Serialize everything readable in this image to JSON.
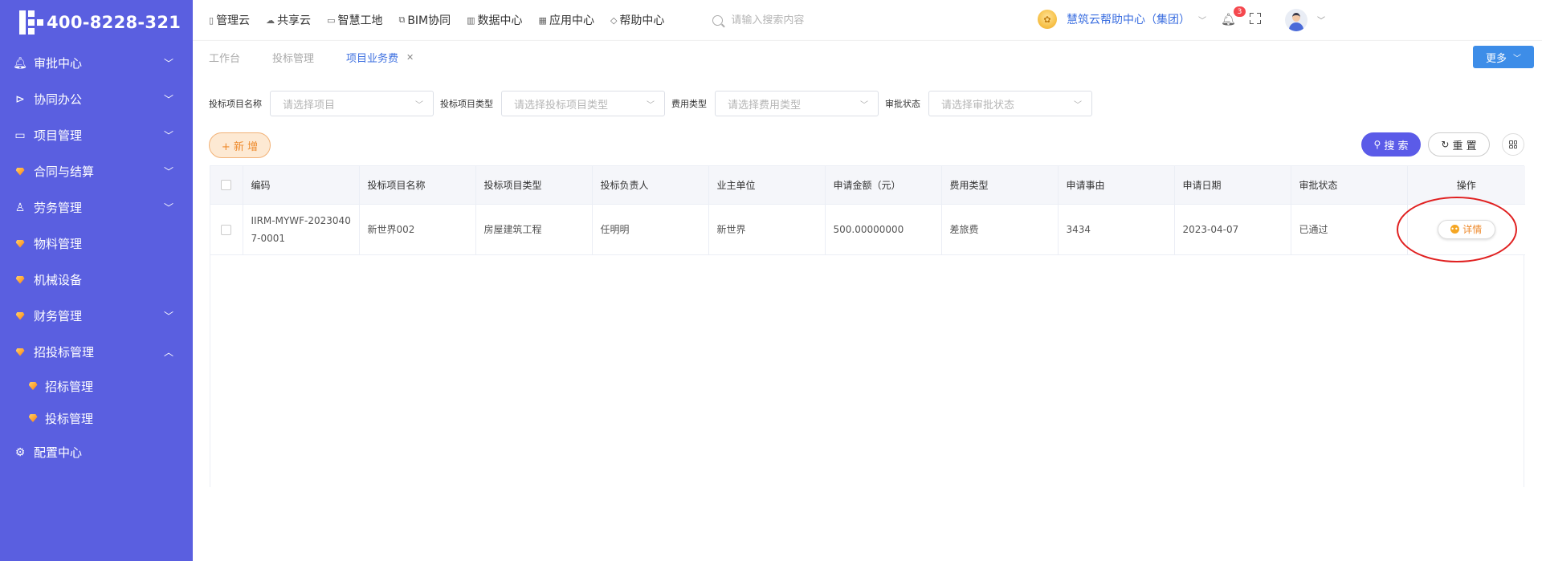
{
  "app": {
    "logo_text": "400-8228-321"
  },
  "sidebar": {
    "items": [
      {
        "label": "审批中心",
        "icon": "bell-icon",
        "expanded": false
      },
      {
        "label": "协同办公",
        "icon": "send-icon",
        "expanded": false
      },
      {
        "label": "项目管理",
        "icon": "book-icon",
        "expanded": false
      },
      {
        "label": "合同与结算",
        "icon": "gem-icon",
        "expanded": false
      },
      {
        "label": "劳务管理",
        "icon": "user-icon",
        "expanded": false
      },
      {
        "label": "物料管理",
        "icon": "gem-icon"
      },
      {
        "label": "机械设备",
        "icon": "gem-icon"
      },
      {
        "label": "财务管理",
        "icon": "gem-icon",
        "expanded": false
      },
      {
        "label": "招投标管理",
        "icon": "gem-icon",
        "expanded": true
      },
      {
        "label": "配置中心",
        "icon": "gear-icon"
      }
    ],
    "sub_items": [
      {
        "label": "招标管理",
        "icon": "gem-icon"
      },
      {
        "label": "投标管理",
        "icon": "gem-icon"
      }
    ]
  },
  "topnav": {
    "items": [
      {
        "label": "管理云",
        "icon": "tablet-icon"
      },
      {
        "label": "共享云",
        "icon": "cloud-icon"
      },
      {
        "label": "智慧工地",
        "icon": "book-icon"
      },
      {
        "label": "BIM协同",
        "icon": "cube-icon"
      },
      {
        "label": "数据中心",
        "icon": "bar-chart-icon"
      },
      {
        "label": "应用中心",
        "icon": "grid-icon"
      },
      {
        "label": "帮助中心",
        "icon": "diamond-icon"
      }
    ],
    "search_placeholder": "请输入搜索内容",
    "org_name": "慧筑云帮助中心（集团）",
    "notification_count": "3"
  },
  "tabs": [
    {
      "label": "工作台",
      "active": false
    },
    {
      "label": "投标管理",
      "active": false
    },
    {
      "label": "项目业务费",
      "active": true,
      "closable": true
    }
  ],
  "more_label": "更多",
  "filters": [
    {
      "label": "投标项目名称",
      "placeholder": "请选择项目"
    },
    {
      "label": "投标项目类型",
      "placeholder": "请选择投标项目类型"
    },
    {
      "label": "费用类型",
      "placeholder": "请选择费用类型"
    },
    {
      "label": "审批状态",
      "placeholder": "请选择审批状态"
    }
  ],
  "toolbar": {
    "add_label": "+ 新 增",
    "search_label": "搜 索",
    "reset_label": "重 置"
  },
  "table": {
    "headers": [
      "编码",
      "投标项目名称",
      "投标项目类型",
      "投标负责人",
      "业主单位",
      "申请金额（元）",
      "费用类型",
      "申请事由",
      "申请日期",
      "审批状态",
      "操作"
    ],
    "rows": [
      {
        "code": "IIRM-MYWF-20230407-0001",
        "project_name": "新世界002",
        "project_type": "房屋建筑工程",
        "owner_person": "任明明",
        "owner_unit": "新世界",
        "amount": "500.00000000",
        "fee_type": "差旅费",
        "reason": "3434",
        "date": "2023-04-07",
        "status": "已通过",
        "action_label": "详情"
      }
    ]
  },
  "colors": {
    "sidebar_bg": "#5a5fe0",
    "primary": "#3c6fe0",
    "accent_orange": "#ee8a2c",
    "search_btn": "#5b5be8",
    "annotation": "#e02020"
  }
}
